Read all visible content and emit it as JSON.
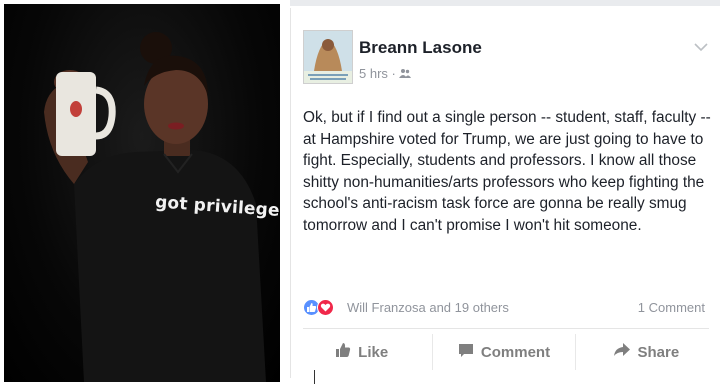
{
  "photo": {
    "shirt_text": "got privilege?"
  },
  "post": {
    "author": "Breann Lasone",
    "time": "5 hrs",
    "audience_icon": "friends-icon",
    "text": "Ok, but if I find out a single person -- student, staff, faculty -- at Hampshire voted for Trump, we are just going to have to fight. Especially, students and professors. I know all those shitty non-humanities/arts professors who keep fighting the school's anti-racism task force are gonna be really smug tomorrow and I can't promise I won't hit someone.",
    "reactions": {
      "names": "Will Franzosa and 19 others",
      "comments": "1 Comment",
      "icons": [
        "like-reaction-icon",
        "love-reaction-icon"
      ]
    },
    "actions": [
      {
        "label": "Like",
        "icon": "thumbs-up-icon"
      },
      {
        "label": "Comment",
        "icon": "comment-icon"
      },
      {
        "label": "Share",
        "icon": "share-arrow-icon"
      }
    ]
  },
  "colors": {
    "text": "#1d2129",
    "muted": "#90949c",
    "like_blue": "#5890ff",
    "love_red": "#f0284a"
  }
}
